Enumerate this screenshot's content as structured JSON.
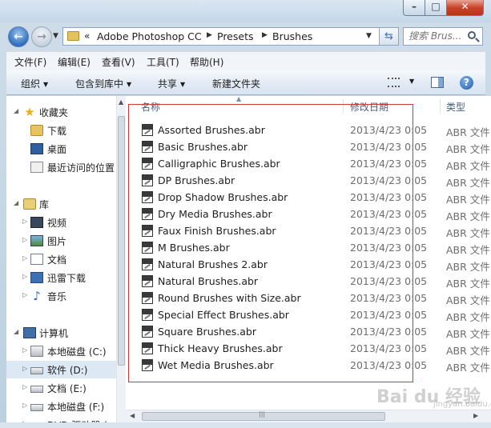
{
  "address": {
    "overflow": "«",
    "crumbs": [
      "Adobe Photoshop CC",
      "Presets",
      "Brushes"
    ]
  },
  "search": {
    "placeholder": "搜索 Brus..."
  },
  "menu": [
    "文件(F)",
    "编辑(E)",
    "查看(V)",
    "工具(T)",
    "帮助(H)"
  ],
  "commands": {
    "organize": "组织",
    "include_library": "包含到库中",
    "share": "共享",
    "new_folder": "新建文件夹"
  },
  "navigation": {
    "favorites": {
      "label": "收藏夹",
      "items": [
        "下载",
        "桌面",
        "最近访问的位置"
      ]
    },
    "libraries": {
      "label": "库",
      "items": [
        "视频",
        "图片",
        "文档",
        "迅雷下载",
        "音乐"
      ]
    },
    "computer": {
      "label": "计算机",
      "items": [
        "本地磁盘 (C:)",
        "软件 (D:)",
        "文档 (E:)",
        "本地磁盘 (F:)",
        "DVD 驱动器 ("
      ]
    }
  },
  "columns": {
    "name": "名称",
    "date": "修改日期",
    "type": "类型"
  },
  "files": [
    {
      "name": "Assorted Brushes.abr",
      "date": "2013/4/23 0:05",
      "type": "ABR 文件"
    },
    {
      "name": "Basic Brushes.abr",
      "date": "2013/4/23 0:05",
      "type": "ABR 文件"
    },
    {
      "name": "Calligraphic Brushes.abr",
      "date": "2013/4/23 0:05",
      "type": "ABR 文件"
    },
    {
      "name": "DP Brushes.abr",
      "date": "2013/4/23 0:05",
      "type": "ABR 文件"
    },
    {
      "name": "Drop Shadow Brushes.abr",
      "date": "2013/4/23 0:05",
      "type": "ABR 文件"
    },
    {
      "name": "Dry Media Brushes.abr",
      "date": "2013/4/23 0:05",
      "type": "ABR 文件"
    },
    {
      "name": "Faux Finish Brushes.abr",
      "date": "2013/4/23 0:05",
      "type": "ABR 文件"
    },
    {
      "name": "M Brushes.abr",
      "date": "2013/4/23 0:05",
      "type": "ABR 文件"
    },
    {
      "name": "Natural Brushes 2.abr",
      "date": "2013/4/23 0:05",
      "type": "ABR 文件"
    },
    {
      "name": "Natural Brushes.abr",
      "date": "2013/4/23 0:05",
      "type": "ABR 文件"
    },
    {
      "name": "Round Brushes with Size.abr",
      "date": "2013/4/23 0:05",
      "type": "ABR 文件"
    },
    {
      "name": "Special Effect Brushes.abr",
      "date": "2013/4/23 0:05",
      "type": "ABR 文件"
    },
    {
      "name": "Square Brushes.abr",
      "date": "2013/4/23 0:05",
      "type": "ABR 文件"
    },
    {
      "name": "Thick Heavy Brushes.abr",
      "date": "2013/4/23 0:05",
      "type": "ABR 文件"
    },
    {
      "name": "Wet Media Brushes.abr",
      "date": "2013/4/23 0:05",
      "type": "ABR 文件"
    }
  ],
  "watermark": {
    "text": "Bai du 经验",
    "sub": "jingyan.baidu.com"
  },
  "colors": {
    "highlight_frame": "#cc3a3a",
    "selected_drive": "#dde8f5"
  }
}
